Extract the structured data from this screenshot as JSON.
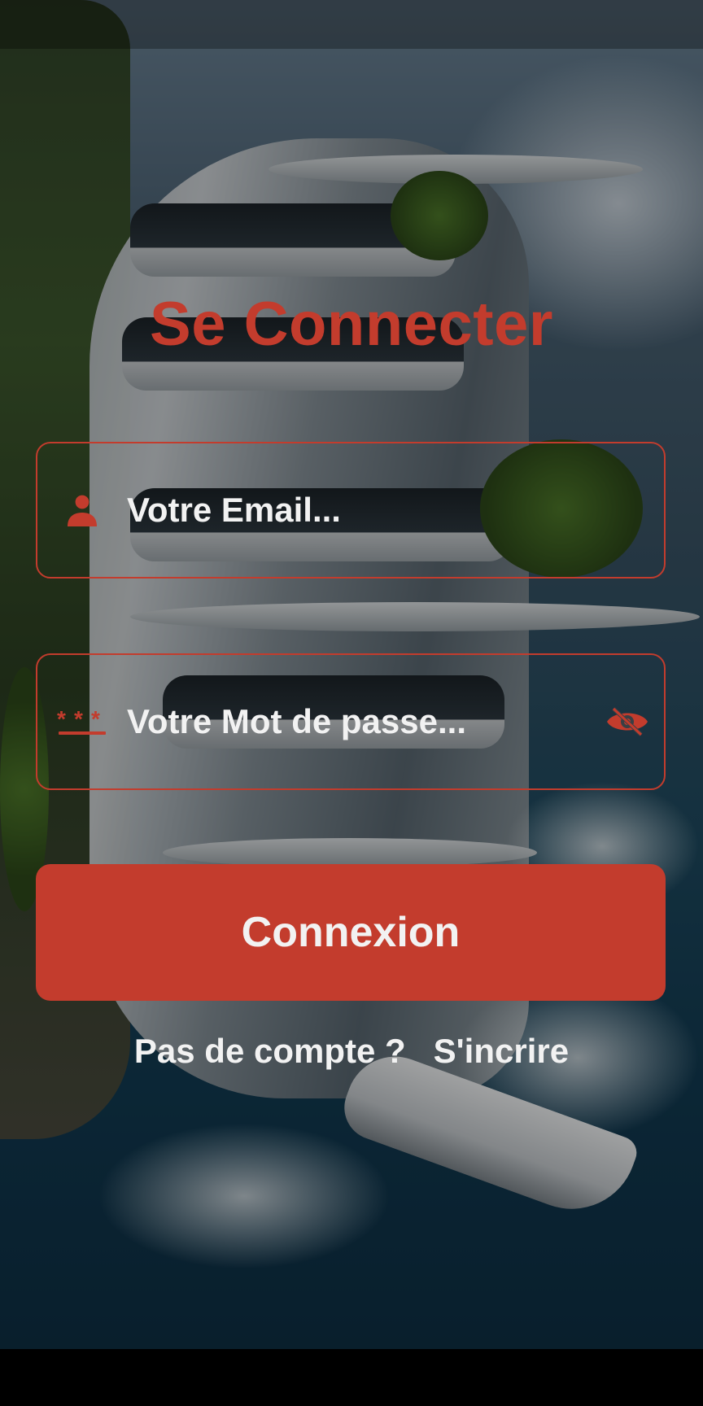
{
  "login": {
    "title": "Se Connecter",
    "email_placeholder": "Votre Email...",
    "password_placeholder": "Votre Mot de passe...",
    "submit_label": "Connexion",
    "no_account_text": "Pas de compte ?",
    "signup_link": "S'incrire"
  },
  "icons": {
    "email": "person-icon",
    "password": "password-asterisks-icon",
    "toggle_visibility": "eye-off-icon"
  },
  "colors": {
    "accent": "#c33c2d",
    "text": "#f2f2f2"
  }
}
